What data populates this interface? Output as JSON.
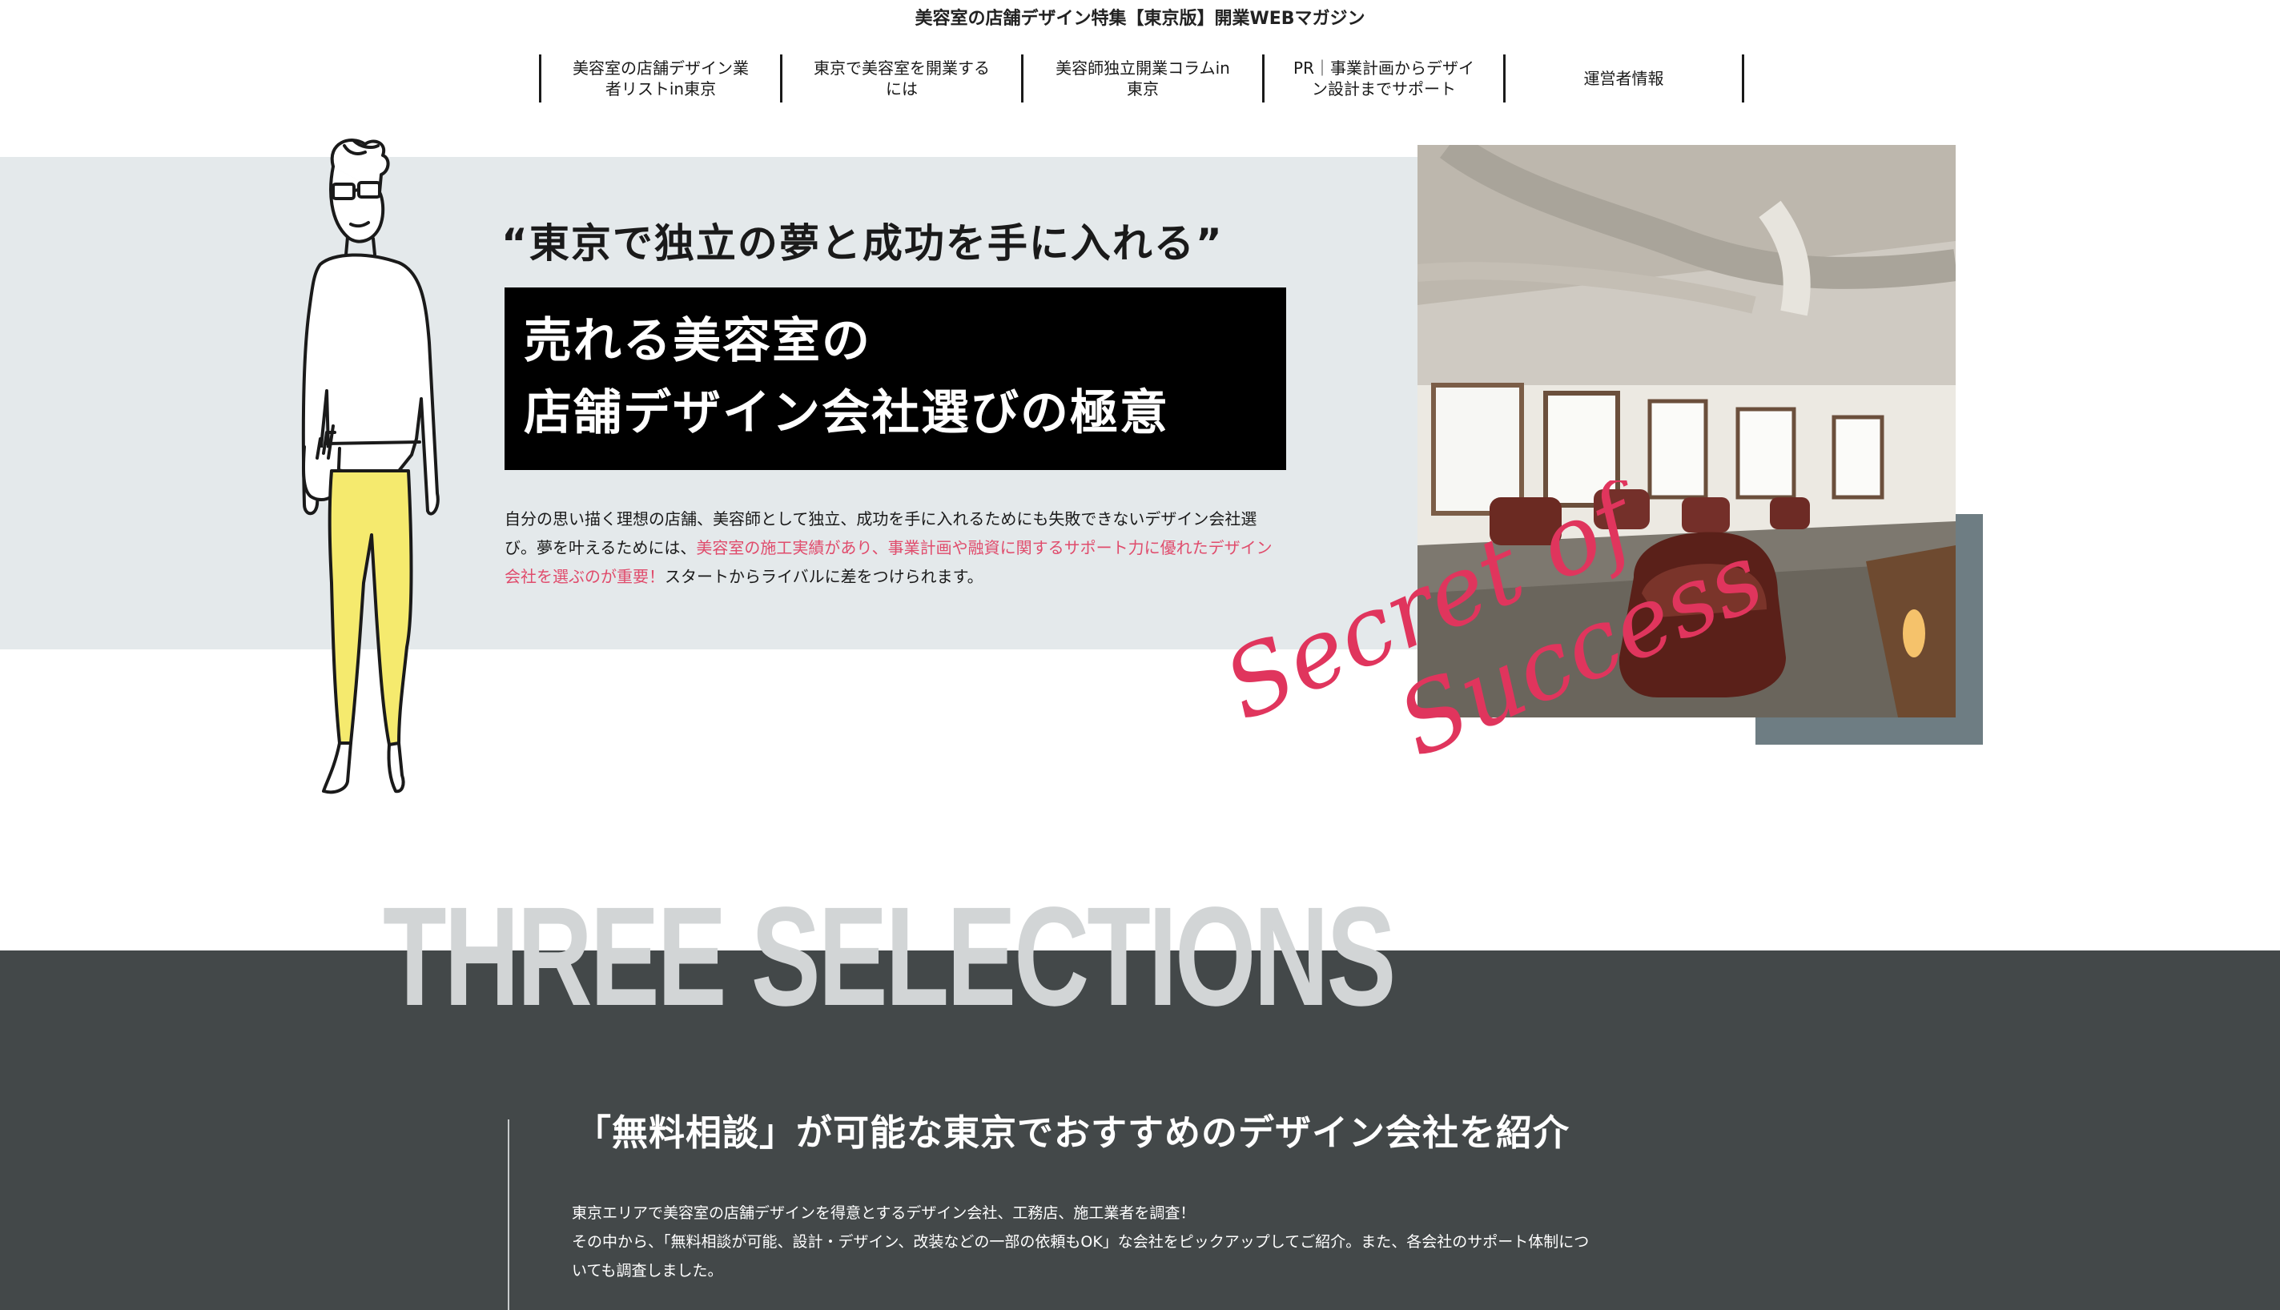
{
  "site": {
    "title": "美容室の店舗デザイン特集【東京版】開業WEBマガジン"
  },
  "nav": [
    {
      "line1": "美容室の店舗デザイン業",
      "line2": "者リストin東京"
    },
    {
      "line1": "東京で美容室を開業する",
      "line2": "には"
    },
    {
      "line1": "美容師独立開業コラムin",
      "line2": "東京"
    },
    {
      "line1": "PR｜事業計画からデザイ",
      "line2": "ン設計までサポート"
    },
    {
      "line1": "運営者情報",
      "line2": ""
    }
  ],
  "hero": {
    "catch": "“東京で独立の夢と成功を手に入れる”",
    "title_line1": "売れる美容室の",
    "title_line2": "店舗デザイン会社選びの極意",
    "lead_part1": "自分の思い描く理想の店舗、美容師として独立、成功を手に入れるためにも失敗できないデザイン会社選び。夢を叶えるためには、",
    "lead_highlight": "美容室の施工実績があり、事業計画や融資に関するサポート力に優れたデザイン会社を選ぶのが重要！",
    "lead_part2": "スタートからライバルに差をつけられます。",
    "script_line1": "Secret of",
    "script_line2": "Success",
    "accent_color": "#e04c6c"
  },
  "selections": {
    "heading": "THREE SELECTIONS",
    "title": "「無料相談」が可能な東京でおすすめのデザイン会社を紹介",
    "body_line1": "東京エリアで美容室の店舗デザインを得意とするデザイン会社、工務店、施工業者を調査！",
    "body_line2": "その中から、「無料相談が可能、設計・デザイン、改装などの一部の依頼もOK」な会社をピックアップしてご紹介。また、各会社のサポート体制につ",
    "body_line3": "いても調査しました。",
    "band_color": "#434849"
  }
}
